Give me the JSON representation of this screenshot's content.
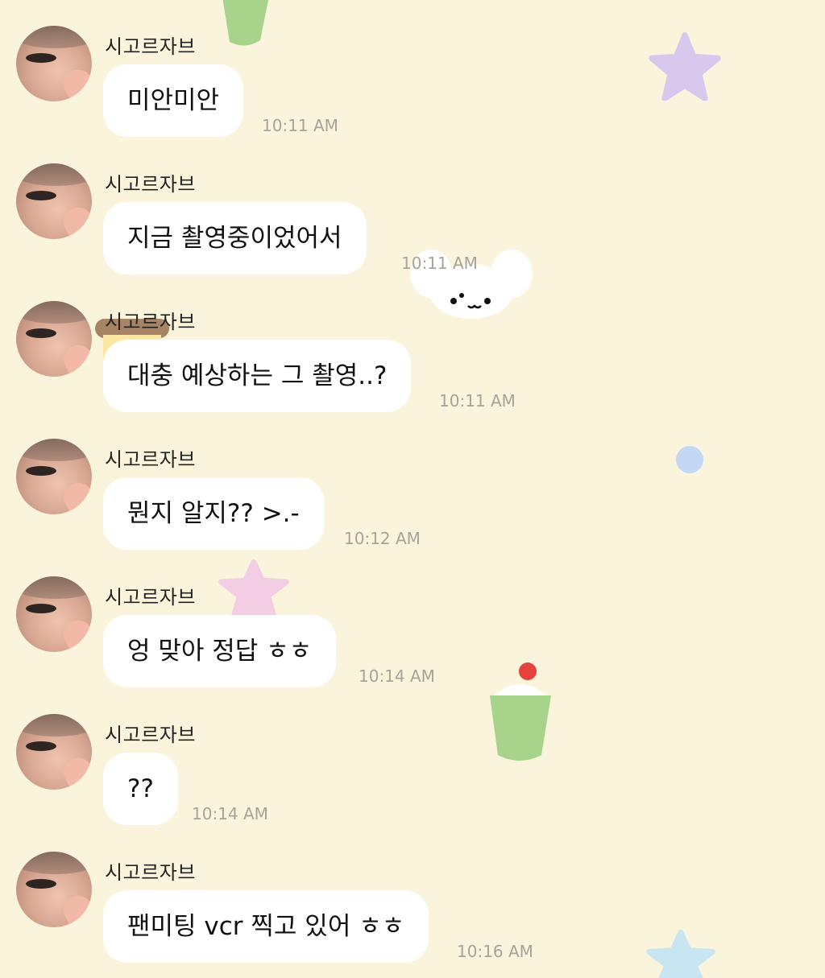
{
  "sender": "시고르자브",
  "messages": [
    {
      "text": "미안미안",
      "time": "10:11 AM"
    },
    {
      "text": "지금 촬영중이었어서",
      "time": "10:11 AM"
    },
    {
      "text": "대충 예상하는 그 촬영..?",
      "time": "10:11 AM"
    },
    {
      "text": "뭔지 알지?? >.-",
      "time": "10:12 AM"
    },
    {
      "text": "엉 맞아 정답 ㅎㅎ",
      "time": "10:14 AM"
    },
    {
      "text": "??",
      "time": "10:14 AM"
    },
    {
      "text": "팬미팅 vcr 찍고 있어 ㅎㅎ",
      "time": "10:16 AM"
    }
  ],
  "colors": {
    "background": "#fbf4dd",
    "bubble": "#ffffff",
    "time_text": "#a6a39a"
  },
  "icons": [
    "cake-sticker-icon",
    "star-sticker-icon",
    "puppy-sticker-icon",
    "dot-sticker-icon"
  ]
}
